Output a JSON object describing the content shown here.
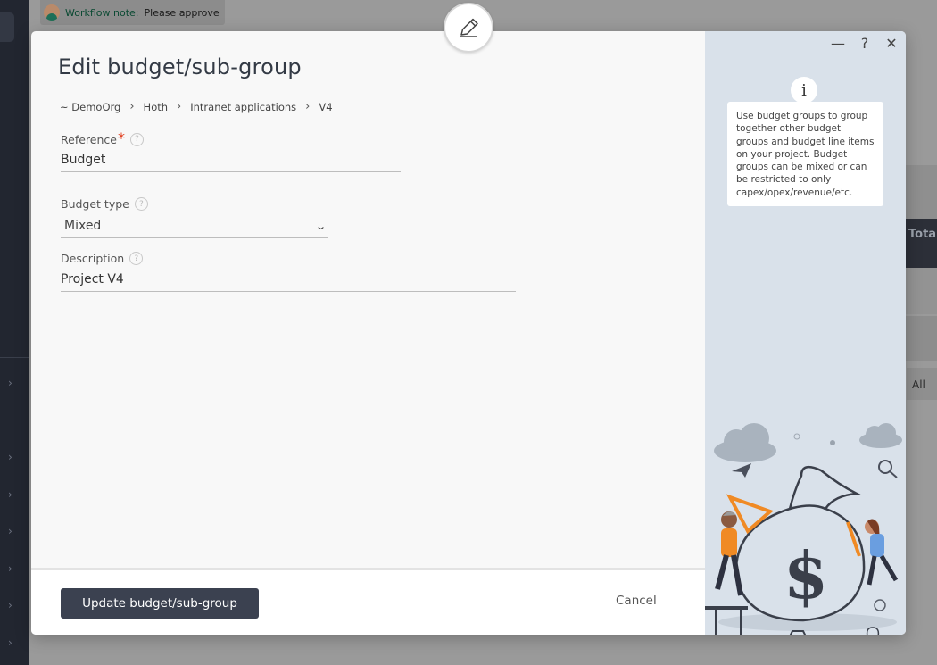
{
  "background": {
    "workflow_note": {
      "label": "Workflow note:",
      "text": "Please approve"
    },
    "table_header": "Total",
    "filter_value": "All"
  },
  "modal": {
    "title": "Edit budget/sub-group",
    "breadcrumb": [
      "~ DemoOrg",
      "Hoth",
      "Intranet applications",
      "V4"
    ],
    "fields": {
      "reference": {
        "label": "Reference",
        "required_mark": "*",
        "value": "Budget"
      },
      "budget_type": {
        "label": "Budget type",
        "value": "Mixed"
      },
      "description": {
        "label": "Description",
        "value": "Project V4"
      }
    },
    "help_glyph": "?",
    "footer": {
      "submit_label": "Update budget/sub-group",
      "cancel_label": "Cancel"
    },
    "window_controls": {
      "minimize": "—",
      "help": "?",
      "close": "✕"
    },
    "side_panel": {
      "info_glyph": "i",
      "info_text": "Use budget groups to group together other budget groups and budget line items on your project. Budget groups can be mixed or can be restricted to only capex/opex/revenue/etc."
    }
  },
  "colors": {
    "primary_button": "#3b4150",
    "required": "#e03a1a",
    "side_panel": "#d9e1ea",
    "accent_orange": "#f08a24"
  }
}
